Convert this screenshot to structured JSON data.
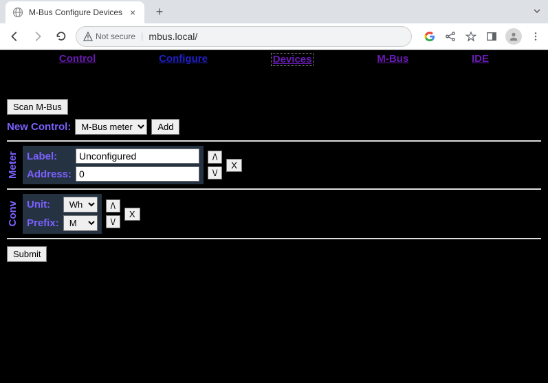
{
  "browser": {
    "tab_title": "M-Bus Configure Devices",
    "security_text": "Not secure",
    "url": "mbus.local/"
  },
  "nav": {
    "control": "Control",
    "configure": "Configure",
    "devices": "Devices",
    "mbus": "M-Bus",
    "ide": "IDE"
  },
  "scan_btn": "Scan M-Bus",
  "new_control_label": "New Control:",
  "new_control_selected": "M-Bus meter",
  "add_btn": "Add",
  "meter": {
    "title": "Meter",
    "label_label": "Label:",
    "label_value": "Unconfigured",
    "address_label": "Address:",
    "address_value": "0"
  },
  "conv": {
    "title": "Conv",
    "unit_label": "Unit:",
    "unit_selected": "Wh",
    "prefix_label": "Prefix:",
    "prefix_selected": "M"
  },
  "up_btn": "/\\",
  "down_btn": "\\/",
  "del_btn": "X",
  "submit_btn": "Submit"
}
